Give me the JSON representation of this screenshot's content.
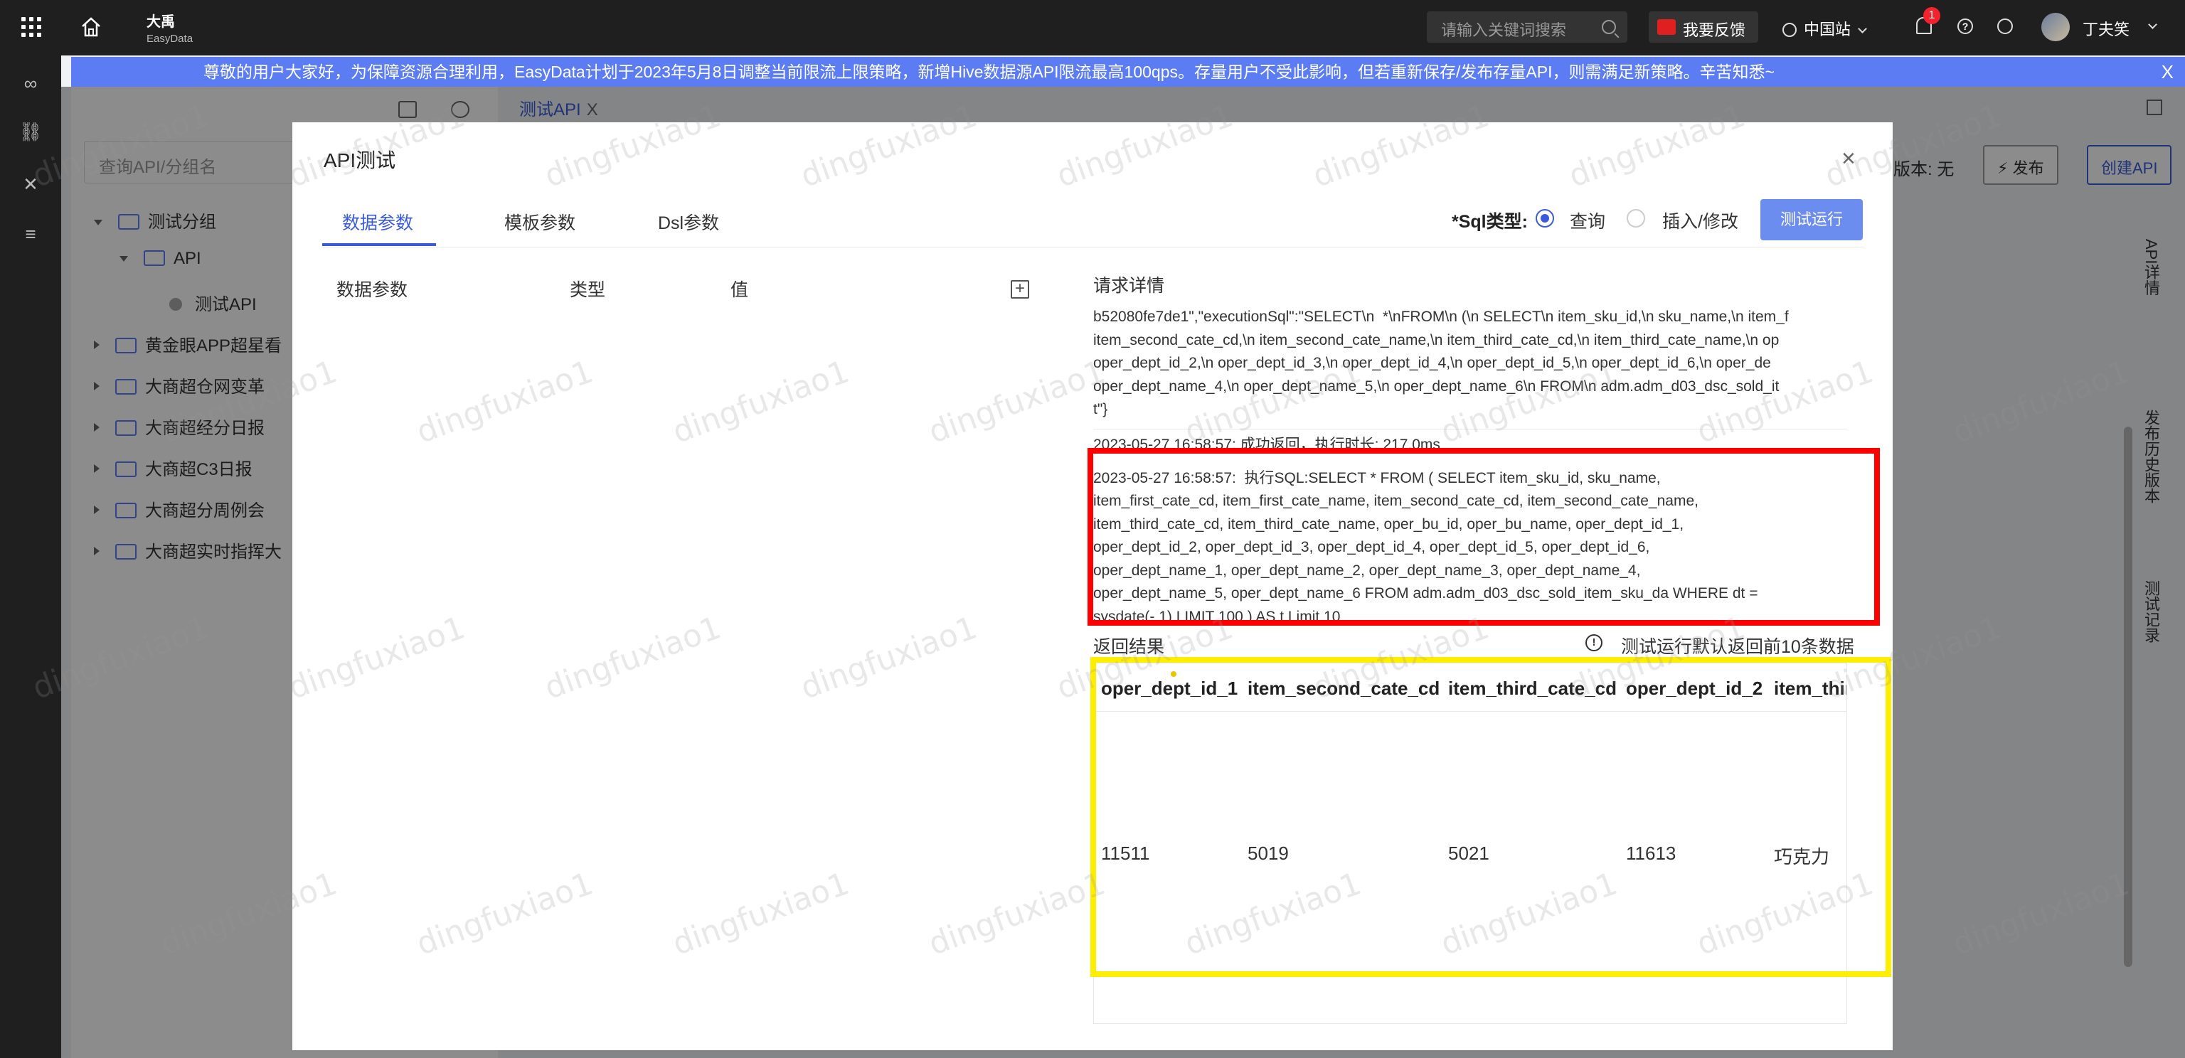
{
  "topbar": {
    "brand_cn": "大禹",
    "brand_en": "EasyData",
    "search_placeholder": "请输入关键词搜索",
    "feedback_label": "我要反馈",
    "site_label": "中国站",
    "notification_count": "1",
    "username": "丁夫笑"
  },
  "banner": {
    "text": "尊敬的用户大家好，为保障资源合理利用，EasyData计划于2023年5月8日调整当前限流上限策略，新增Hive数据源API限流最高100qps。存量用户不受此影响，但若重新保存/发布存量API，则需满足新策略。辛苦知悉~",
    "close": "X"
  },
  "background": {
    "tab_label": "测试API",
    "tab_close": "X",
    "search_placeholder": "查询API/分组名",
    "tree": [
      {
        "label": "测试分组"
      },
      {
        "label": "API"
      },
      {
        "label": "测试API"
      },
      {
        "label": "黄金眼APP超星看"
      },
      {
        "label": "大商超仓网变革"
      },
      {
        "label": "大商超经分日报"
      },
      {
        "label": "大商超C3日报"
      },
      {
        "label": "大商超分周例会"
      },
      {
        "label": "大商超实时指挥大"
      }
    ],
    "version_label": "版本: 无",
    "publish_label": "发布",
    "create_api_label": "创建API",
    "side_tabs": [
      "API详情",
      "发布历史版本",
      "测试记录"
    ]
  },
  "modal": {
    "title": "API测试",
    "close": "×",
    "tabs": [
      "数据参数",
      "模板参数",
      "Dsl参数"
    ],
    "sql_type_label": "*Sql类型:",
    "radio_query": "查询",
    "radio_insert": "插入/修改",
    "run_button": "测试运行",
    "param_headers": [
      "数据参数",
      "类型",
      "值"
    ],
    "request_title": "请求详情",
    "log_pre": "b52080fe7de1\",\"executionSql\":\"SELECT\\n  *\\nFROM\\n (\\n SELECT\\n item_sku_id,\\n sku_name,\\n item_f\nitem_second_cate_cd,\\n item_second_cate_name,\\n item_third_cate_cd,\\n item_third_cate_name,\\n op\noper_dept_id_2,\\n oper_dept_id_3,\\n oper_dept_id_4,\\n oper_dept_id_5,\\n oper_dept_id_6,\\n oper_de\noper_dept_name_4,\\n oper_dept_name_5,\\n oper_dept_name_6\\n FROM\\n adm.adm_d03_dsc_sold_it\nt\"}",
    "log_success": "2023-05-27 16:58:57:  成功返回，执行时长: 217.0ms",
    "log_sql": "2023-05-27 16:58:57:  执行SQL:SELECT * FROM ( SELECT item_sku_id, sku_name,\nitem_first_cate_cd, item_first_cate_name, item_second_cate_cd, item_second_cate_name,\nitem_third_cate_cd, item_third_cate_name, oper_bu_id, oper_bu_name, oper_dept_id_1,\noper_dept_id_2, oper_dept_id_3, oper_dept_id_4, oper_dept_id_5, oper_dept_id_6,\noper_dept_name_1, oper_dept_name_2, oper_dept_name_3, oper_dept_name_4,\noper_dept_name_5, oper_dept_name_6 FROM adm.adm_d03_dsc_sold_item_sku_da WHERE dt =\nsysdate(- 1) LIMIT 100 ) AS t Limit 10",
    "result_title": "返回结果",
    "result_note": "测试运行默认返回前10条数据",
    "result_columns": [
      "oper_dept_id_1",
      "item_second_cate_cd",
      "item_third_cate_cd",
      "oper_dept_id_2",
      "item_third_"
    ],
    "result_row": [
      "11511",
      "5019",
      "5021",
      "11613",
      "巧克力"
    ]
  },
  "watermark": "dingfuxiao1",
  "colors": {
    "accent": "#3b5bdb",
    "banner": "#5b7cf3",
    "run_button": "#6c8df0",
    "highlight_red": "#ff0000",
    "highlight_yellow": "#ffee00"
  }
}
